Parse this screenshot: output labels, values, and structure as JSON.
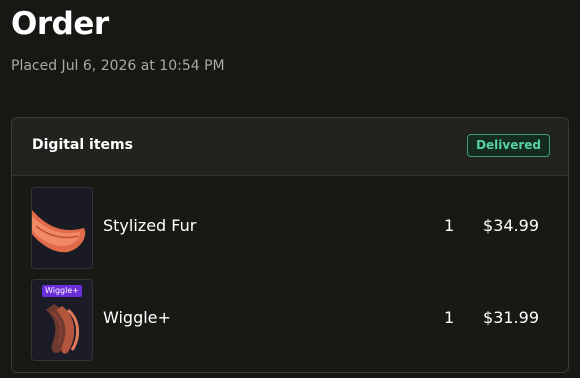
{
  "page": {
    "title": "Order",
    "placed": "Placed Jul 6, 2026 at 10:54 PM"
  },
  "card": {
    "title": "Digital items",
    "status": "Delivered"
  },
  "items": [
    {
      "name": "Stylized Fur",
      "quantity": "1",
      "price": "$34.99",
      "thumbnail": "orange-fur-tuft-image"
    },
    {
      "name": "Wiggle+",
      "quantity": "1",
      "price": "$31.99",
      "thumbnail": "wiggle-fur-tuft-image",
      "thumbnail_tag": "Wiggle+"
    }
  ],
  "colors": {
    "background": "#171714",
    "status_green": "#56d3a1",
    "tag_purple": "#6b2cd9"
  }
}
